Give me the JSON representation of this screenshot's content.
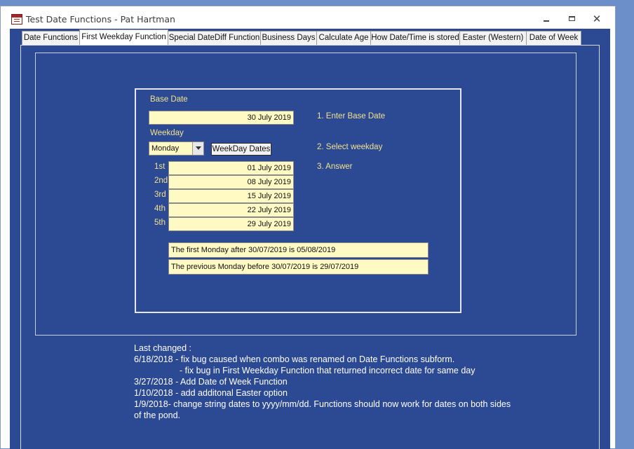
{
  "window": {
    "title": "Test Date Functions - Pat Hartman",
    "minimize": "",
    "maximize": "",
    "close": "✕"
  },
  "tabs": [
    {
      "label": "Date Functions"
    },
    {
      "label": "First Weekday Function"
    },
    {
      "label": "Special DateDiff Function"
    },
    {
      "label": "Business Days"
    },
    {
      "label": "Calculate Age"
    },
    {
      "label": "How Date/Time is stored"
    },
    {
      "label": "Easter (Western)"
    },
    {
      "label": "Date of Week"
    }
  ],
  "form": {
    "base_date_label": "Base Date",
    "base_date_value": "30 July 2019",
    "weekday_label": "Weekday",
    "weekday_value": "Monday",
    "weekday_button": "WeekDay Dates",
    "step1": "1. Enter Base Date",
    "step2": "2. Select weekday",
    "step3": "3. Answer",
    "answers": [
      {
        "label": "1st",
        "value": "01 July 2019"
      },
      {
        "label": "2nd",
        "value": "08 July 2019"
      },
      {
        "label": "3rd",
        "value": "15 July 2019"
      },
      {
        "label": "4th",
        "value": "22 July 2019"
      },
      {
        "label": "5th",
        "value": "29 July 2019"
      }
    ],
    "first_after": "The first Monday after 30/07/2019 is 05/08/2019",
    "previous_before": "The previous Monday before 30/07/2019 is 29/07/2019"
  },
  "notes": {
    "lines": [
      "Last changed :",
      "6/18/2018 - fix bug caused when combo was renamed on Date Functions subform.",
      "                - fix bug in First Weekday Function that returned incorrect date for same day",
      "3/27/2018 - Add Date of Week Function",
      "1/10/2018 - add additonal Easter option",
      "1/9/2018- change string dates to yyyy/mm/dd.  Functions should now work for dates on both sides",
      "of the pond."
    ]
  },
  "colors": {
    "body_bg": "#2c4a94",
    "field_bg": "#fff9c4",
    "label": "#f2e28a"
  }
}
